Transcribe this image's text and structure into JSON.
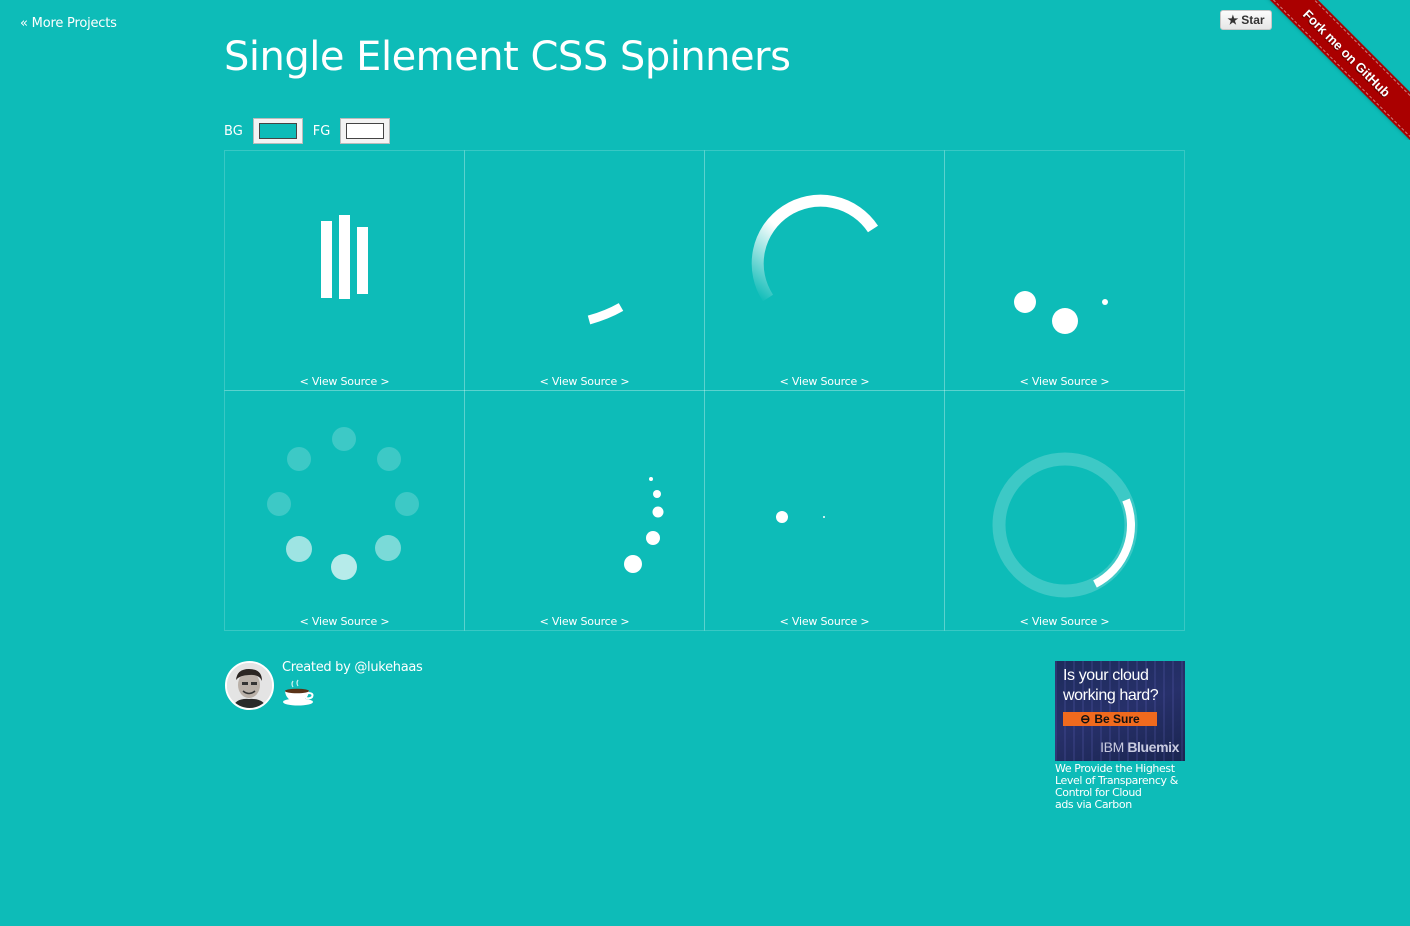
{
  "header": {
    "more_projects": "« More Projects",
    "title": "Single Element CSS Spinners",
    "star_label": "Star",
    "ribbon_label": "Fork me on GitHub"
  },
  "controls": {
    "bg_label": "BG",
    "fg_label": "FG",
    "bg_color": "#0dbcb8",
    "fg_color": "#ffffff"
  },
  "spinners": [
    {
      "id": "bars",
      "link": "< View Source >"
    },
    {
      "id": "arc-small",
      "link": "< View Source >"
    },
    {
      "id": "arc-fade",
      "link": "< View Source >"
    },
    {
      "id": "three-dots",
      "link": "< View Source >"
    },
    {
      "id": "dot-circle",
      "link": "< View Source >"
    },
    {
      "id": "dot-trail",
      "link": "< View Source >"
    },
    {
      "id": "two-dots",
      "link": "< View Source >"
    },
    {
      "id": "ring",
      "link": "< View Source >"
    }
  ],
  "footer": {
    "created_by": "Created by @lukehaas"
  },
  "ad": {
    "headline": "Is your cloud working hard?",
    "cta": "Be Sure",
    "brand_light": "IBM ",
    "brand_bold": "Bluemix",
    "text": "We Provide the Highest Level of Transparency & Control for Cloud",
    "via": "ads via Carbon"
  },
  "colors": {
    "background": "#0dbcb8",
    "foreground": "#ffffff",
    "ribbon": "#aa0000",
    "ad_cta": "#f06a1e"
  }
}
